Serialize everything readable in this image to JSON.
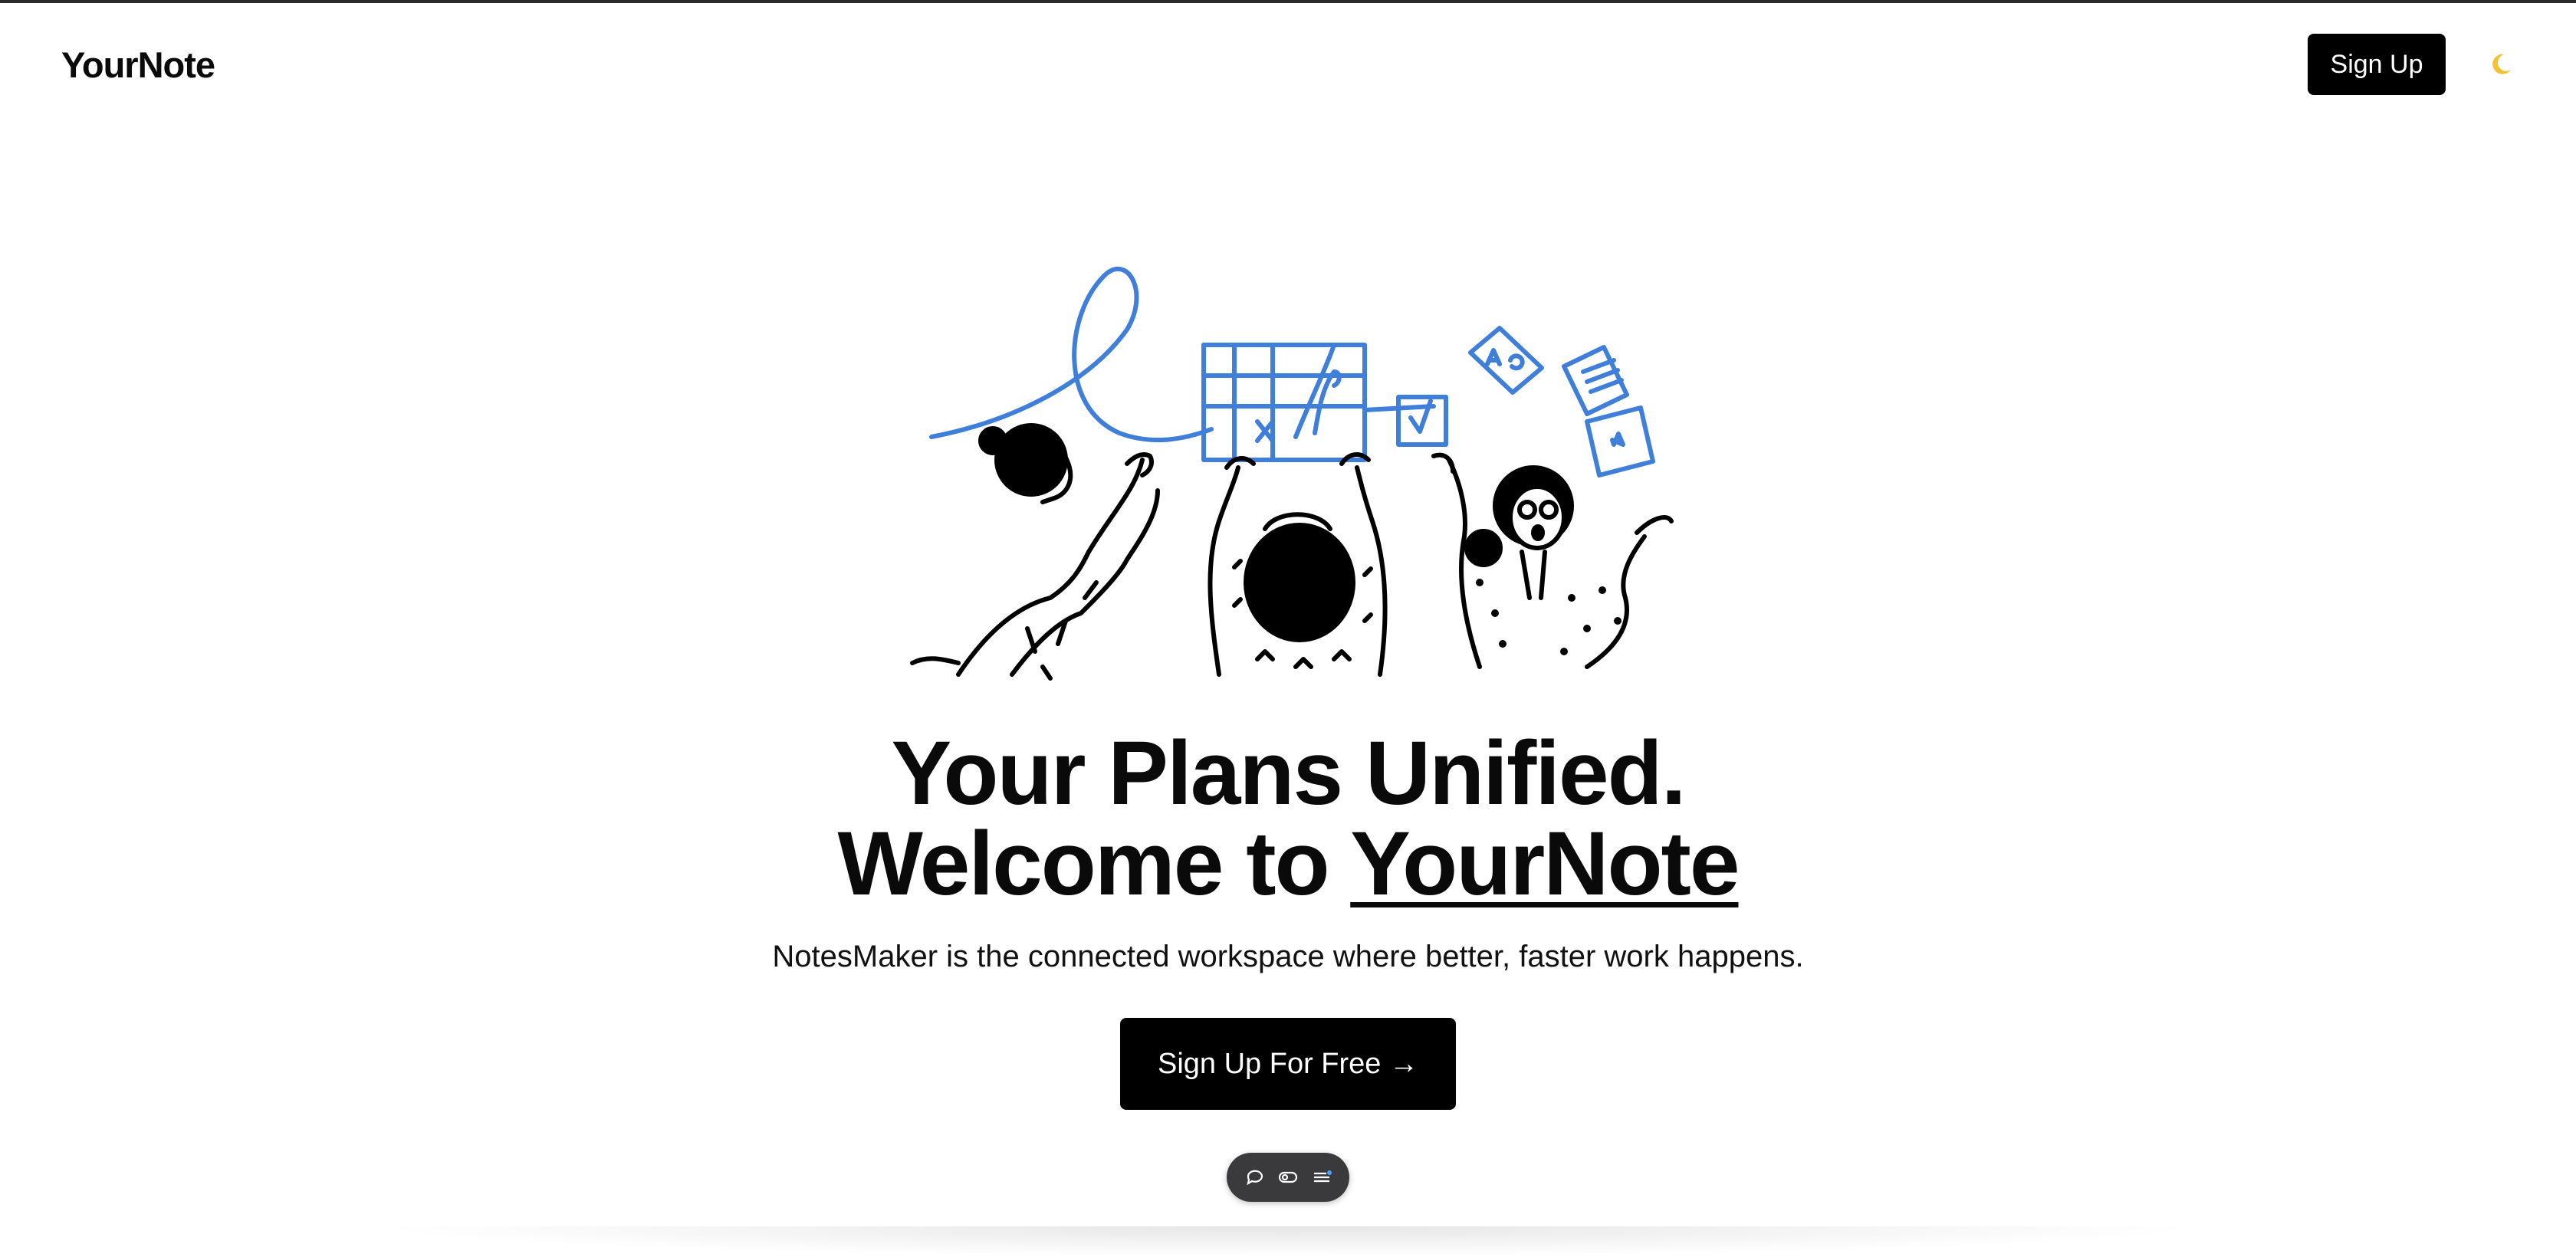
{
  "header": {
    "logo": "YourNote",
    "signup_label": "Sign Up",
    "theme_toggle_icon": "moon-icon"
  },
  "hero": {
    "illustration": "people-collaborating-illustration",
    "headline_line1": "Your Plans Unified.",
    "headline_line2_prefix": "Welcome to ",
    "headline_brand": "YourNote",
    "subtitle": "NotesMaker is the connected workspace where better, faster work happens.",
    "cta_label": "Sign Up For Free →"
  },
  "toolbar": {
    "items": [
      {
        "icon": "comment-icon"
      },
      {
        "icon": "toggle-icon"
      },
      {
        "icon": "menu-icon"
      }
    ]
  },
  "colors": {
    "accent": "#3f7fd9",
    "primary": "#000000",
    "background": "#ffffff",
    "toolbar": "#3a3a3c"
  }
}
